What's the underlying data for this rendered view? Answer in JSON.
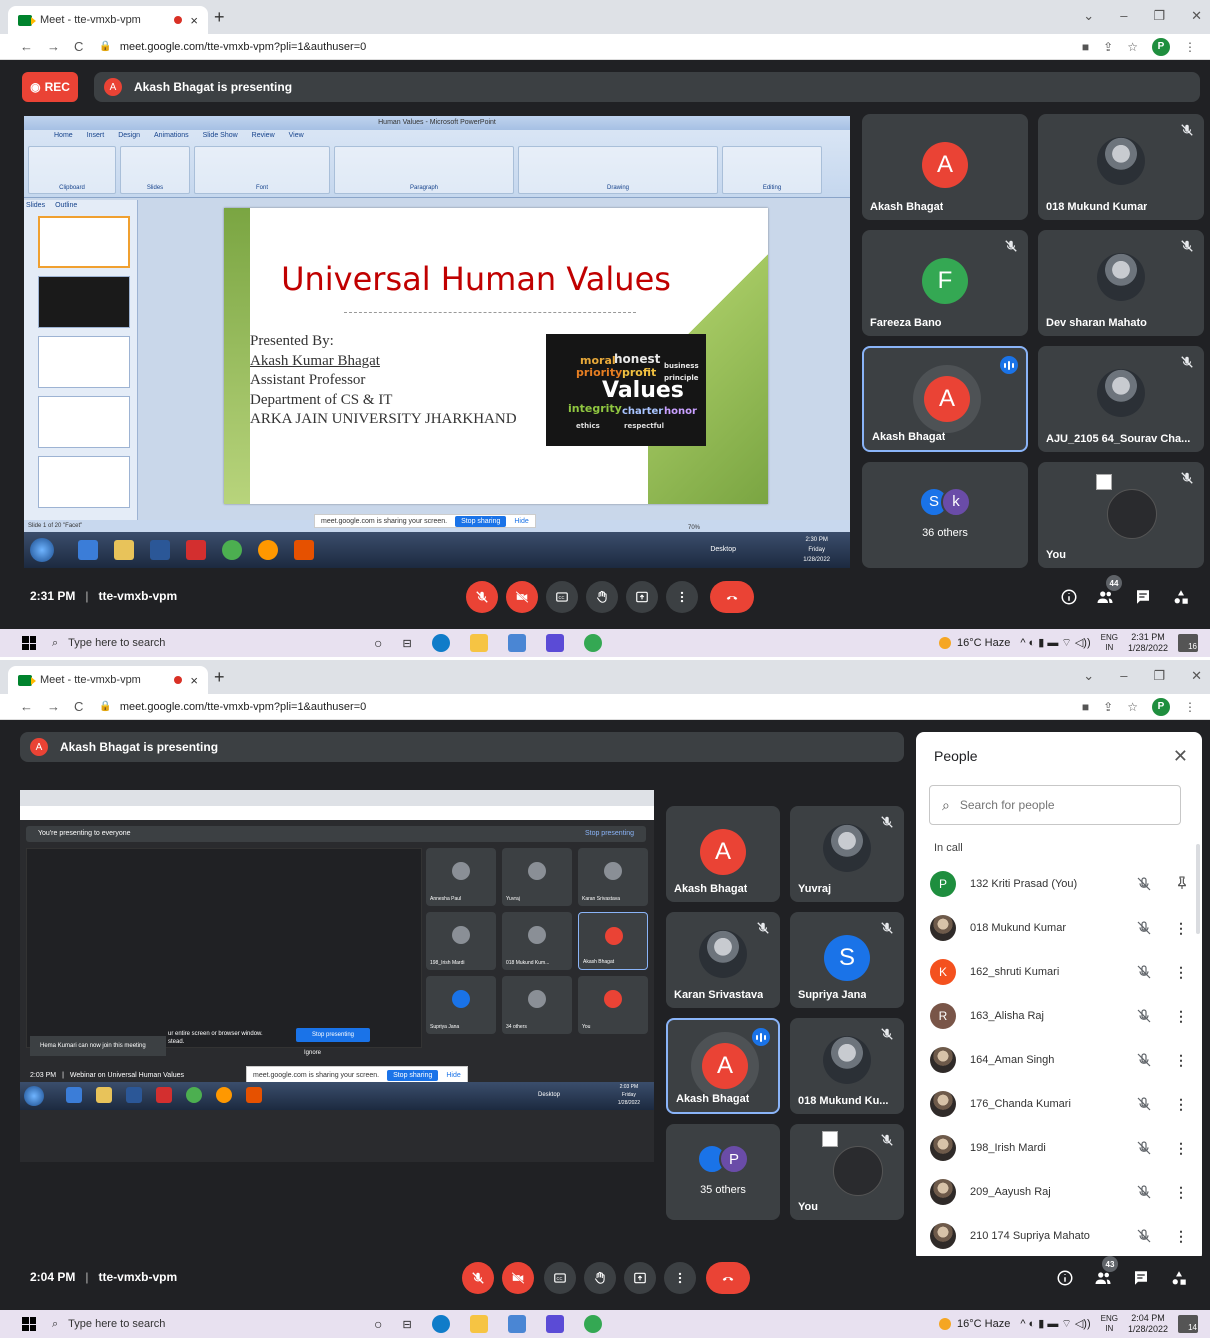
{
  "browser": {
    "tab_title": "Meet - tte-vmxb-vpm",
    "tab_close": "×",
    "new_tab": "+",
    "url": "meet.google.com/tte-vmxb-vpm?pli=1&authuser=0",
    "profile_initial": "P"
  },
  "shot1": {
    "rec_label": "REC",
    "presenting_text": "Akash Bhagat is presenting",
    "presenter_initial": "A",
    "slide": {
      "window_title": "Human Values - Microsoft PowerPoint",
      "tabs": [
        "Home",
        "Insert",
        "Design",
        "Animations",
        "Slide Show",
        "Review",
        "View"
      ],
      "groups": [
        "Clipboard",
        "Slides",
        "Font",
        "Paragraph",
        "Drawing",
        "Editing"
      ],
      "panel_tabs": [
        "Slides",
        "Outline"
      ],
      "title": "Universal Human Values",
      "presented_by": "Presented By:",
      "name": "Akash Kumar Bhagat",
      "role": "Assistant Professor",
      "dept": "Department of CS & IT",
      "org": "ARKA JAIN UNIVERSITY JHARKHAND",
      "status": "Slide 1 of 20   \"Facet\"",
      "zoom": "70%",
      "share_msg": "meet.google.com is sharing your screen.",
      "stop_sharing": "Stop sharing",
      "hide": "Hide",
      "inner_time": "2:30 PM",
      "inner_day": "Friday",
      "inner_date": "1/28/2022",
      "inner_desktop": "Desktop",
      "words": [
        "moral",
        "honest",
        "priority",
        "profit",
        "Values",
        "integrity",
        "charter",
        "honor",
        "business",
        "principle",
        "ethics",
        "respectful"
      ]
    },
    "tiles": [
      {
        "name": "Akash Bhagat",
        "initial": "A",
        "color": "#ea4335",
        "muted": false,
        "type": "avatar"
      },
      {
        "name": "018 Mukund Kumar",
        "muted": true,
        "type": "photo"
      },
      {
        "name": "Fareeza Bano",
        "initial": "F",
        "color": "#34a853",
        "muted": true,
        "type": "avatar"
      },
      {
        "name": "Dev sharan Mahato",
        "muted": true,
        "type": "photo"
      },
      {
        "name": "Akash Bhagat",
        "initial": "A",
        "color": "#ea4335",
        "speaking": true,
        "type": "avatar"
      },
      {
        "name": "AJU_2105 64_Sourav Cha...",
        "muted": true,
        "type": "photo"
      },
      {
        "name": "36 others",
        "initials": [
          "S",
          "k"
        ],
        "type": "others"
      },
      {
        "name": "You",
        "muted": true,
        "type": "broken"
      }
    ],
    "time": "2:31 PM",
    "meeting_code": "tte-vmxb-vpm",
    "people_count": "44",
    "taskbar_time": "2:31 PM",
    "taskbar_date": "1/28/2022",
    "notif_count": "16"
  },
  "shot2": {
    "presenting_text": "Akash Bhagat is presenting",
    "presenter_initial": "A",
    "mini": {
      "banner": "You're presenting to everyone",
      "stop_presenting": "Stop presenting",
      "join_toast": "Hema Kumari can now join this meeting",
      "share_text": "ur entire screen or browser window.",
      "share_text2": "stead.",
      "stop_btn": "Stop presenting",
      "ignore": "Ignore",
      "time": "2:03 PM",
      "title": "Webinar on Universal Human Values",
      "share_msg": "meet.google.com is sharing your screen.",
      "stop_sharing": "Stop sharing",
      "hide": "Hide",
      "inner_time": "2:03 PM",
      "inner_day": "Friday",
      "inner_date": "1/28/2022",
      "inner_desktop": "Desktop",
      "tiles": [
        "Annesha Paul",
        "Yuvraj",
        "Karan Srivastava",
        "198_Irish Mardi",
        "018 Mukund Kum...",
        "Akash Bhagat",
        "Supriya Jana",
        "34 others",
        "You"
      ]
    },
    "tiles": [
      {
        "name": "Akash Bhagat",
        "initial": "A",
        "color": "#ea4335",
        "type": "avatar"
      },
      {
        "name": "Yuvraj",
        "muted": true,
        "type": "photo"
      },
      {
        "name": "Karan Srivastava",
        "muted": true,
        "type": "photo"
      },
      {
        "name": "Supriya Jana",
        "initial": "S",
        "color": "#1a73e8",
        "muted": true,
        "type": "avatar"
      },
      {
        "name": "Akash Bhagat",
        "initial": "A",
        "color": "#ea4335",
        "speaking": true,
        "type": "avatar"
      },
      {
        "name": "018 Mukund Ku...",
        "muted": true,
        "type": "photo"
      },
      {
        "name": "35 others",
        "initials": [
          "",
          "P"
        ],
        "type": "others"
      },
      {
        "name": "You",
        "muted": true,
        "type": "broken"
      }
    ],
    "people_panel": {
      "title": "People",
      "search_placeholder": "Search for people",
      "section": "In call",
      "people": [
        {
          "name": "132 Kriti Prasad (You)",
          "initial": "P",
          "color": "#1e8e3e",
          "photo": false
        },
        {
          "name": "018 Mukund Kumar",
          "photo": true
        },
        {
          "name": "162_shruti Kumari",
          "initial": "K",
          "color": "#f4511e",
          "photo": false
        },
        {
          "name": "163_Alisha Raj",
          "initial": "R",
          "color": "#795548",
          "photo": false
        },
        {
          "name": "164_Aman Singh",
          "photo": true
        },
        {
          "name": "176_Chanda Kumari",
          "photo": true
        },
        {
          "name": "198_Irish Mardi",
          "photo": true
        },
        {
          "name": "209_Aayush Raj",
          "photo": true
        },
        {
          "name": "210 174 Supriya Mahato",
          "photo": true
        }
      ]
    },
    "time": "2:04 PM",
    "meeting_code": "tte-vmxb-vpm",
    "people_count": "43",
    "taskbar_time": "2:04 PM",
    "taskbar_date": "1/28/2022",
    "notif_count": "14"
  },
  "windows": {
    "search_placeholder": "Type here to search",
    "weather": "16°C  Haze",
    "lang1": "ENG",
    "lang2": "IN"
  },
  "colors": {
    "meet_bg": "#202124",
    "tile_bg": "#3c4043",
    "red": "#ea4335",
    "blue": "#1a73e8"
  }
}
